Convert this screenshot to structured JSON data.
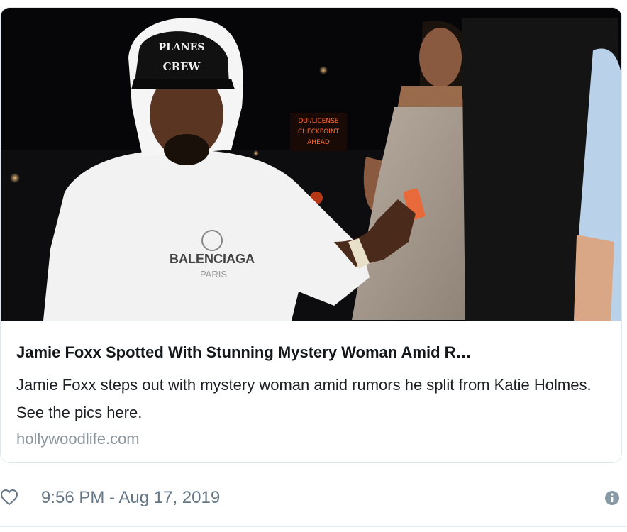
{
  "card": {
    "image": {
      "hat_text_top": "PLANES",
      "hat_text_bottom": "CREW",
      "shirt_brand": "BALENCIAGA",
      "shirt_city": "PARIS",
      "sign_line1": "DUI/LICENSE",
      "sign_line2": "CHECKPOINT",
      "sign_line3": "AHEAD"
    },
    "title": "Jamie Foxx Spotted With Stunning Mystery Woman Amid R…",
    "description": "Jamie Foxx steps out with mystery woman amid rumors he split from Katie Holmes. See the pics here.",
    "domain": "hollywoodlife.com"
  },
  "footer": {
    "timestamp": "9:56 PM - Aug 17, 2019",
    "like_icon": "heart-icon",
    "info_icon": "info-icon"
  },
  "colors": {
    "text_primary": "#14171a",
    "text_secondary": "#657786",
    "border": "#e1e8ed"
  }
}
